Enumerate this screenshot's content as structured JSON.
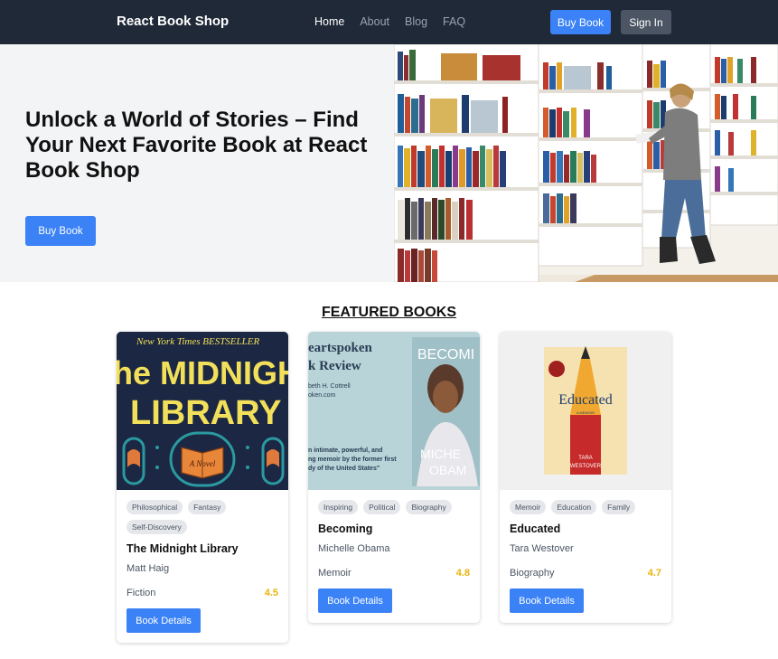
{
  "nav": {
    "brand": "React Book Shop",
    "links": [
      "Home",
      "About",
      "Blog",
      "FAQ"
    ],
    "buy_label": "Buy Book",
    "signin_label": "Sign In"
  },
  "hero": {
    "title": "Unlock a World of Stories – Find Your Next Favorite Book at React Book Shop",
    "button_label": "Buy Book"
  },
  "featured": {
    "heading": "FEATURED BOOKS",
    "books": [
      {
        "tags": [
          "Philosophical",
          "Fantasy",
          "Self-Discovery"
        ],
        "title": "The Midnight Library",
        "author": "Matt Haig",
        "genre": "Fiction",
        "rating": "4.5",
        "button_label": "Book Details",
        "cover": {
          "line1": "New York Times BESTSELLER",
          "line2": "he MIDNIGH",
          "line3": "LIBRARY",
          "badge": "A Novel"
        }
      },
      {
        "tags": [
          "Inspiring",
          "Political",
          "Biography"
        ],
        "title": "Becoming",
        "author": "Michelle Obama",
        "genre": "Memoir",
        "rating": "4.8",
        "button_label": "Book Details",
        "cover": {
          "line1": "eartspoken",
          "line2": "k Review",
          "line3": "beth H. Cottrell",
          "line4": "oken.com",
          "quote": "n intimate, powerful, and\nng memoir by the former first\ndy of the United States\"",
          "title": "BECOMI",
          "name1": "MICHE",
          "name2": "OBAM"
        }
      },
      {
        "tags": [
          "Memoir",
          "Education",
          "Family"
        ],
        "title": "Educated",
        "author": "Tara Westover",
        "genre": "Biography",
        "rating": "4.7",
        "button_label": "Book Details",
        "cover": {
          "title": "Educated",
          "subtitle": "A MEMOIR",
          "author1": "TARA",
          "author2": "WESTOVER"
        }
      }
    ]
  },
  "colors": {
    "navbar": "#1f2937",
    "primary": "#3b82f6",
    "secondary": "#4b5563",
    "rating": "#eab308"
  }
}
